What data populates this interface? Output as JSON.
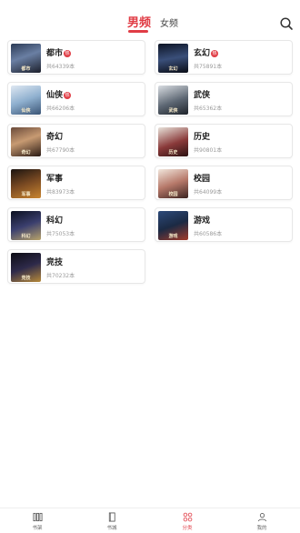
{
  "header": {
    "tabs": [
      {
        "label": "男频",
        "active": true
      },
      {
        "label": "女频",
        "active": false
      }
    ],
    "search_icon": "search-icon",
    "accent_color": "#e03c45"
  },
  "categories": [
    {
      "name": "都市",
      "hot": true,
      "hot_label": "热",
      "count": "共64339本"
    },
    {
      "name": "玄幻",
      "hot": true,
      "hot_label": "热",
      "count": "共75891本"
    },
    {
      "name": "仙侠",
      "hot": true,
      "hot_label": "热",
      "count": "共66206本"
    },
    {
      "name": "武侠",
      "hot": false,
      "count": "共65362本"
    },
    {
      "name": "奇幻",
      "hot": false,
      "count": "共67790本"
    },
    {
      "name": "历史",
      "hot": false,
      "count": "共90801本"
    },
    {
      "name": "军事",
      "hot": false,
      "count": "共83973本"
    },
    {
      "name": "校园",
      "hot": false,
      "count": "共64099本"
    },
    {
      "name": "科幻",
      "hot": false,
      "count": "共75053本"
    },
    {
      "name": "游戏",
      "hot": false,
      "count": "共60586本"
    },
    {
      "name": "竞技",
      "hot": false,
      "count": "共70232本"
    }
  ],
  "bottom_nav": [
    {
      "label": "书架",
      "icon": "bookshelf-icon",
      "active": false
    },
    {
      "label": "书城",
      "icon": "book-icon",
      "active": false
    },
    {
      "label": "分类",
      "icon": "category-grid-icon",
      "active": true
    },
    {
      "label": "我的",
      "icon": "user-icon",
      "active": false
    }
  ]
}
